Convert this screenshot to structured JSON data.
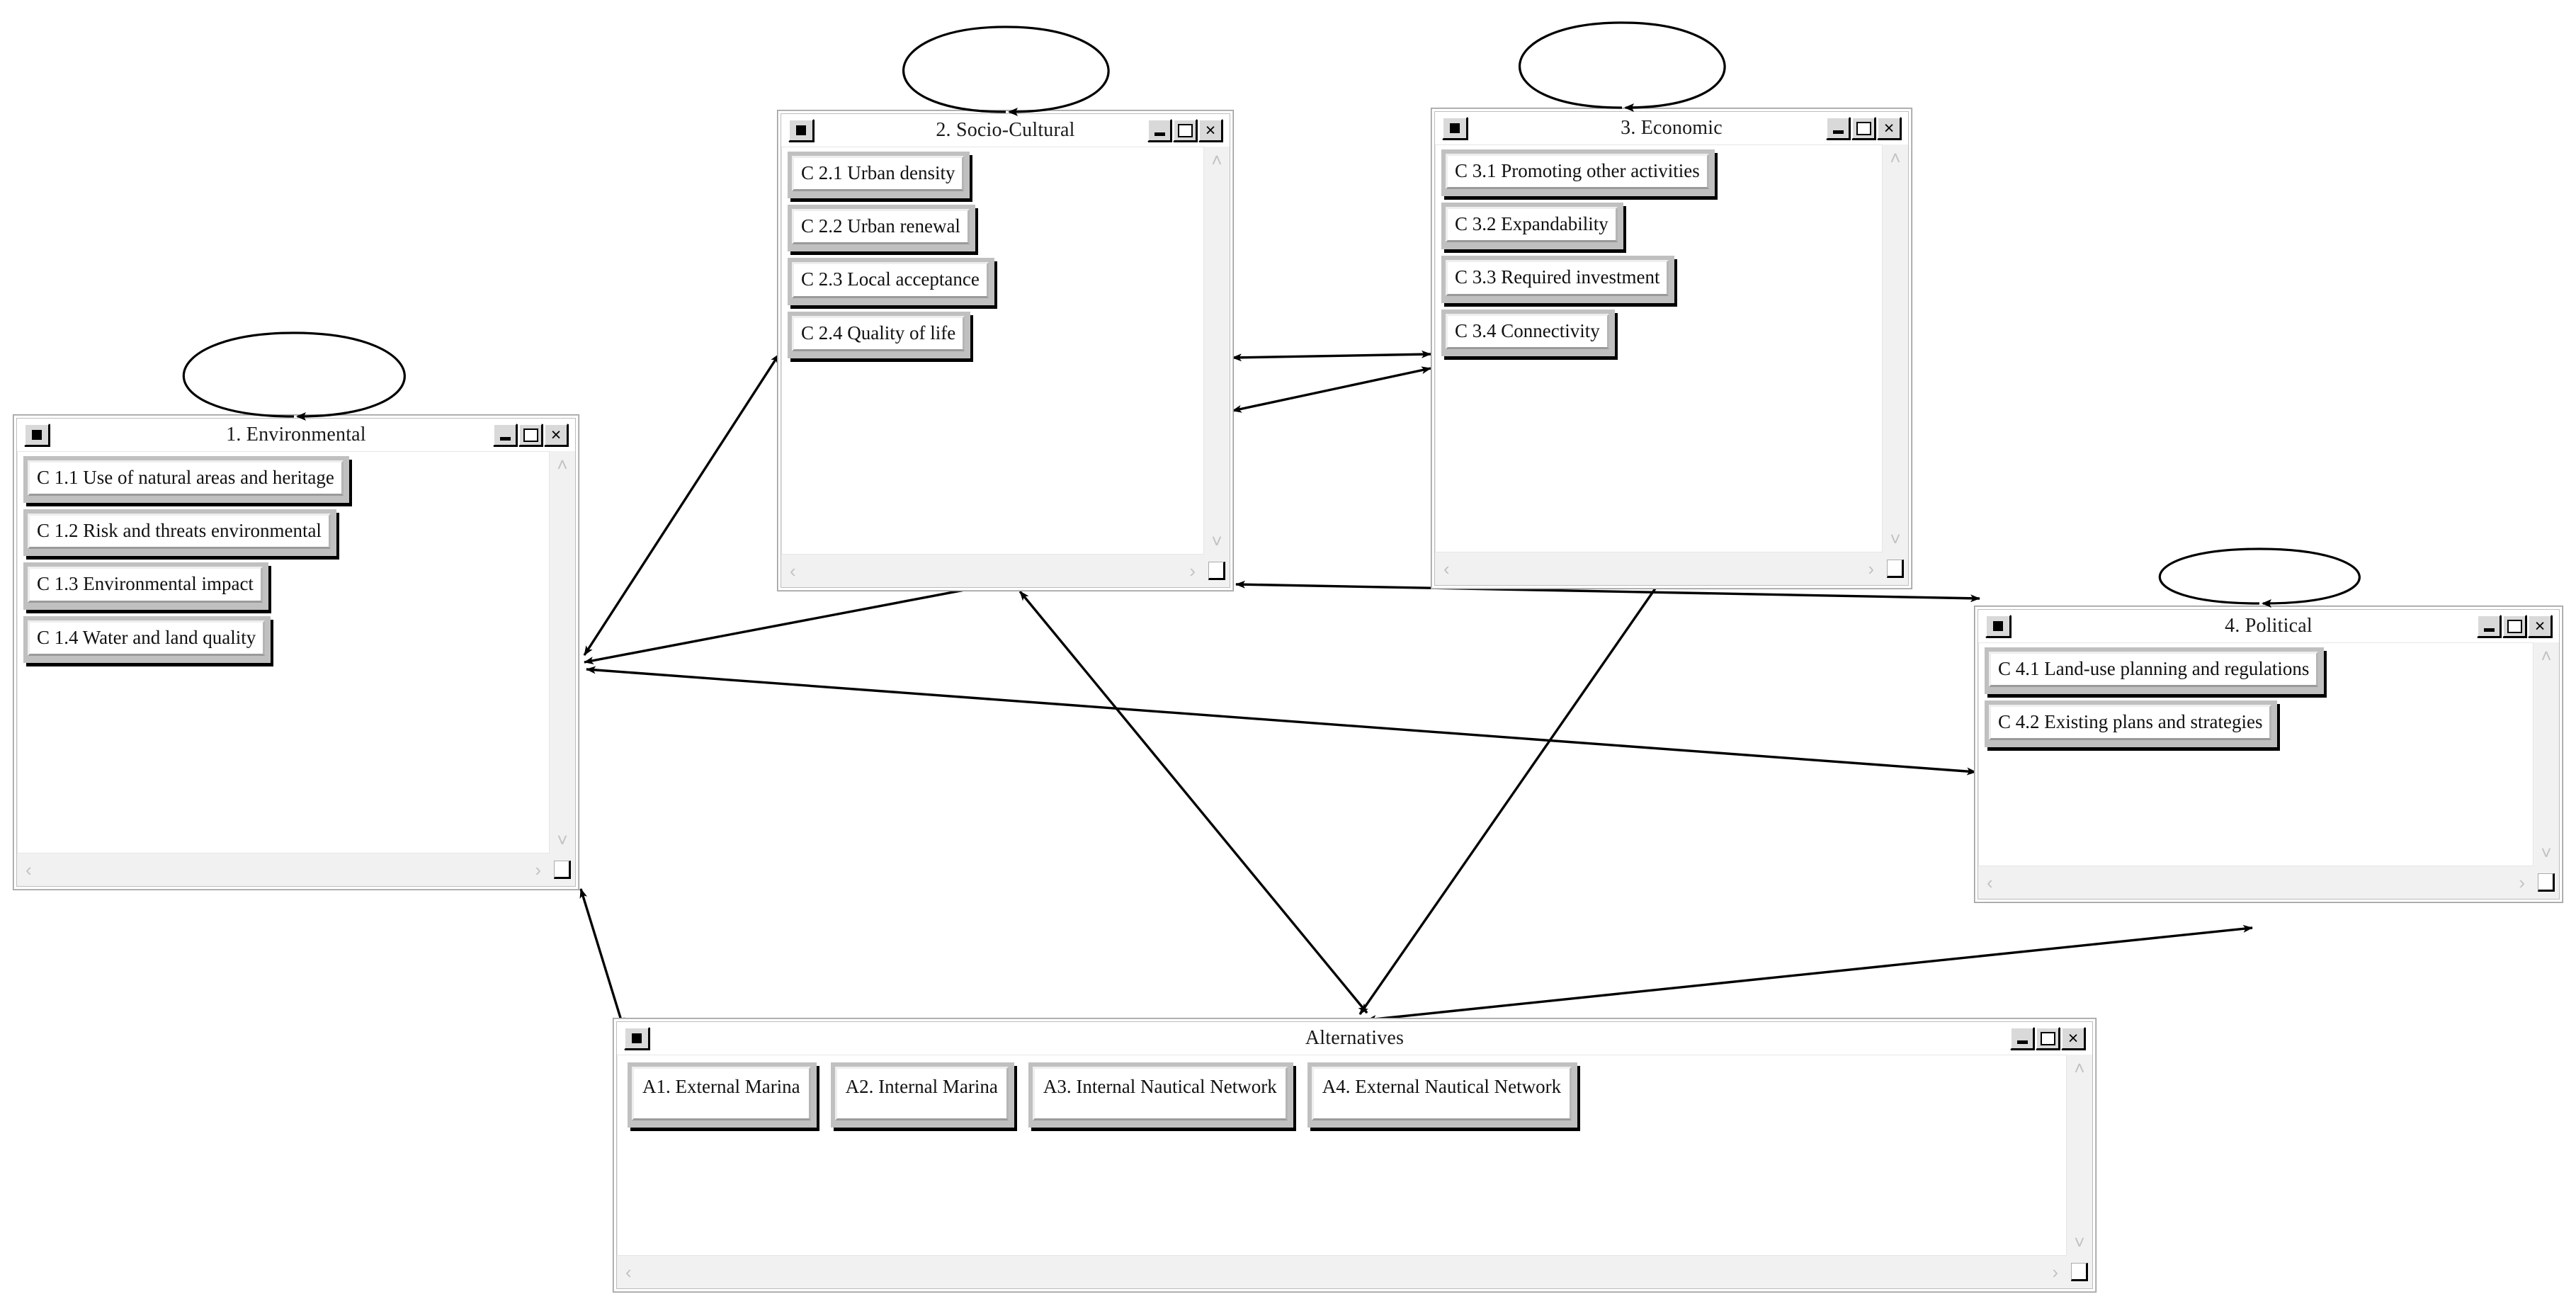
{
  "diagram": {
    "type": "anp-network-model",
    "window_controls": {
      "system_menu": "system-menu-box",
      "minimize": "–",
      "maximize": "□",
      "close": "×"
    },
    "scroll": {
      "left": "‹",
      "right": "›",
      "up": "˄",
      "down": "˅"
    },
    "colors": {
      "window_bg": "#ffffff",
      "window_border": "#9a9a9a",
      "node_frame": "#c0c0c0",
      "node_face": "#ffffff",
      "scrollbar": "#f1f1f1",
      "link": "#000000",
      "text": "#111111"
    }
  },
  "clusters": [
    {
      "id": "environmental",
      "title": "1. Environmental",
      "nodes": [
        {
          "label": "C 1.1 Use of natural areas and heritage"
        },
        {
          "label": "C 1.2 Risk and threats environmental"
        },
        {
          "label": "C 1.3 Environmental impact"
        },
        {
          "label": "C 1.4 Water and land quality"
        }
      ]
    },
    {
      "id": "socio-cultural",
      "title": "2. Socio-Cultural",
      "nodes": [
        {
          "label": "C 2.1 Urban density"
        },
        {
          "label": "C 2.2 Urban renewal"
        },
        {
          "label": "C 2.3 Local acceptance"
        },
        {
          "label": "C 2.4 Quality of life"
        }
      ]
    },
    {
      "id": "economic",
      "title": "3. Economic",
      "nodes": [
        {
          "label": "C 3.1 Promoting other activities"
        },
        {
          "label": "C 3.2 Expandability"
        },
        {
          "label": "C 3.3 Required investment"
        },
        {
          "label": "C 3.4 Connectivity"
        }
      ]
    },
    {
      "id": "political",
      "title": "4. Political",
      "nodes": [
        {
          "label": "C 4.1 Land-use planning and regulations"
        },
        {
          "label": "C 4.2 Existing plans and strategies"
        }
      ]
    },
    {
      "id": "alternatives",
      "title": "Alternatives",
      "nodes": [
        {
          "label": "A1. External Marina"
        },
        {
          "label": "A2. Internal Marina"
        },
        {
          "label": "A3. Internal Nautical Network"
        },
        {
          "label": "A4. External Nautical Network"
        }
      ]
    }
  ],
  "self_loops": [
    {
      "cluster": "environmental"
    },
    {
      "cluster": "socio-cultural"
    },
    {
      "cluster": "economic"
    },
    {
      "cluster": "political"
    }
  ],
  "links": [
    {
      "from": "environmental",
      "to": "socio-cultural",
      "arrows": "both"
    },
    {
      "from": "environmental",
      "to": "economic",
      "arrows": "both"
    },
    {
      "from": "environmental",
      "to": "political",
      "arrows": "both"
    },
    {
      "from": "environmental",
      "to": "alternatives",
      "arrows": "both"
    },
    {
      "from": "socio-cultural",
      "to": "economic",
      "arrows": "both"
    },
    {
      "from": "socio-cultural",
      "to": "alternatives",
      "arrows": "both"
    },
    {
      "from": "economic",
      "to": "political",
      "arrows": "both"
    },
    {
      "from": "economic",
      "to": "alternatives",
      "arrows": "both"
    },
    {
      "from": "political",
      "to": "alternatives",
      "arrows": "both"
    }
  ]
}
